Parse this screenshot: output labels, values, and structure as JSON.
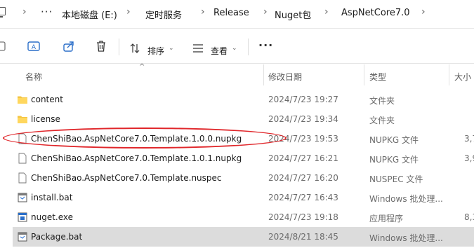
{
  "breadcrumb": {
    "more": "···",
    "items": [
      "本地磁盘 (E:)",
      "定时服务",
      "Release",
      "Nuget包",
      "AspNetCore7.0"
    ]
  },
  "toolbar": {
    "sort_label": "排序",
    "view_label": "查看",
    "more_label": "···"
  },
  "columns": {
    "name": "名称",
    "modified": "修改日期",
    "type": "类型",
    "size": "大小"
  },
  "files": [
    {
      "name": "content",
      "modified": "2024/7/23 19:27",
      "type": "文件夹",
      "size": "",
      "icon": "folder-icon"
    },
    {
      "name": "license",
      "modified": "2024/7/23 19:34",
      "type": "文件夹",
      "size": "",
      "icon": "folder-icon"
    },
    {
      "name": "ChenShiBao.AspNetCore7.0.Template.1.0.0.nupkg",
      "modified": "2024/7/23 19:53",
      "type": "NUPKG 文件",
      "size": "3,7",
      "icon": "file-icon"
    },
    {
      "name": "ChenShiBao.AspNetCore7.0.Template.1.0.1.nupkg",
      "modified": "2024/7/27 16:21",
      "type": "NUPKG 文件",
      "size": "3,9",
      "icon": "file-icon"
    },
    {
      "name": "ChenShiBao.AspNetCore7.0.Template.nuspec",
      "modified": "2024/7/27 16:20",
      "type": "NUSPEC 文件",
      "size": "",
      "icon": "file-icon"
    },
    {
      "name": "install.bat",
      "modified": "2024/7/27 16:43",
      "type": "Windows 批处理...",
      "size": "",
      "icon": "batch-file-icon"
    },
    {
      "name": "nuget.exe",
      "modified": "2024/7/23 19:18",
      "type": "应用程序",
      "size": "8,3",
      "icon": "exe-icon"
    },
    {
      "name": "Package.bat",
      "modified": "2024/8/21 18:45",
      "type": "Windows 批处理...",
      "size": "",
      "icon": "batch-file-icon"
    }
  ],
  "colors": {
    "selection": "#dcdcdc",
    "highlight_oval": "#e0262a",
    "folder": "#f4c542"
  }
}
